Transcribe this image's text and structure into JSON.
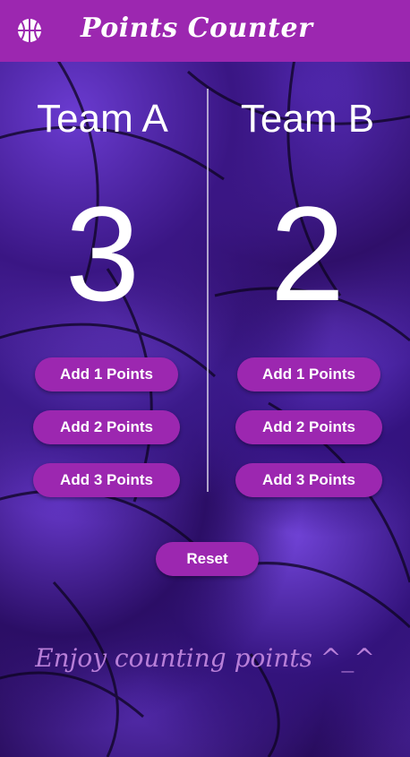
{
  "app_bar": {
    "title": "Points Counter",
    "icon": "basketball-icon",
    "color": "#9c27b0"
  },
  "team_a": {
    "name": "Team A",
    "score": "3",
    "buttons": [
      "Add 1 Points",
      "Add 2 Points",
      "Add 3 Points"
    ]
  },
  "team_b": {
    "name": "Team B",
    "score": "2",
    "buttons": [
      "Add 1 Points",
      "Add 2 Points",
      "Add 3 Points"
    ]
  },
  "reset_label": "Reset",
  "footer_text": "Enjoy counting points ^_^"
}
